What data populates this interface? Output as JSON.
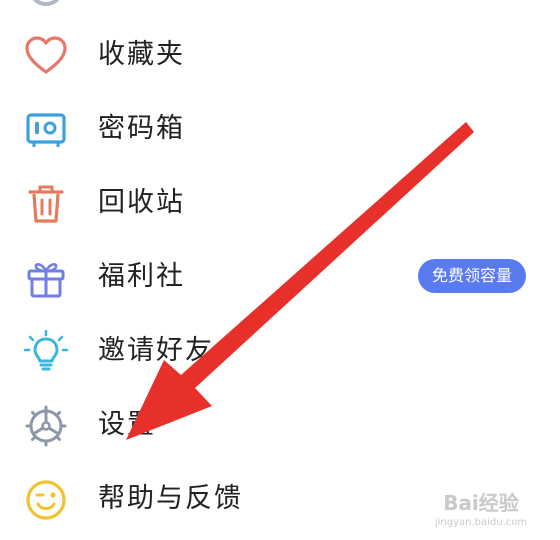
{
  "menu": {
    "items": [
      {
        "label": "收藏夹",
        "icon": "heart-icon"
      },
      {
        "label": "密码箱",
        "icon": "safe-box-icon"
      },
      {
        "label": "回收站",
        "icon": "trash-icon"
      },
      {
        "label": "福利社",
        "icon": "gift-icon",
        "badge": "免费领容量"
      },
      {
        "label": "邀请好友",
        "icon": "lightbulb-icon"
      },
      {
        "label": "设置",
        "icon": "gear-icon"
      },
      {
        "label": "帮助与反馈",
        "icon": "smiley-icon"
      }
    ]
  },
  "colors": {
    "heart": "#e8776a",
    "safe": "#3aa0e0",
    "trash": "#e57b5a",
    "gift": "#6f7ee8",
    "bulb": "#3bb7dd",
    "gear": "#8c97a8",
    "smiley": "#f2c230",
    "badge": "#5a7af0",
    "arrow": "#e8302a"
  },
  "watermark": {
    "logo": "Bai经验",
    "url": "jingyan.baidu.com"
  }
}
